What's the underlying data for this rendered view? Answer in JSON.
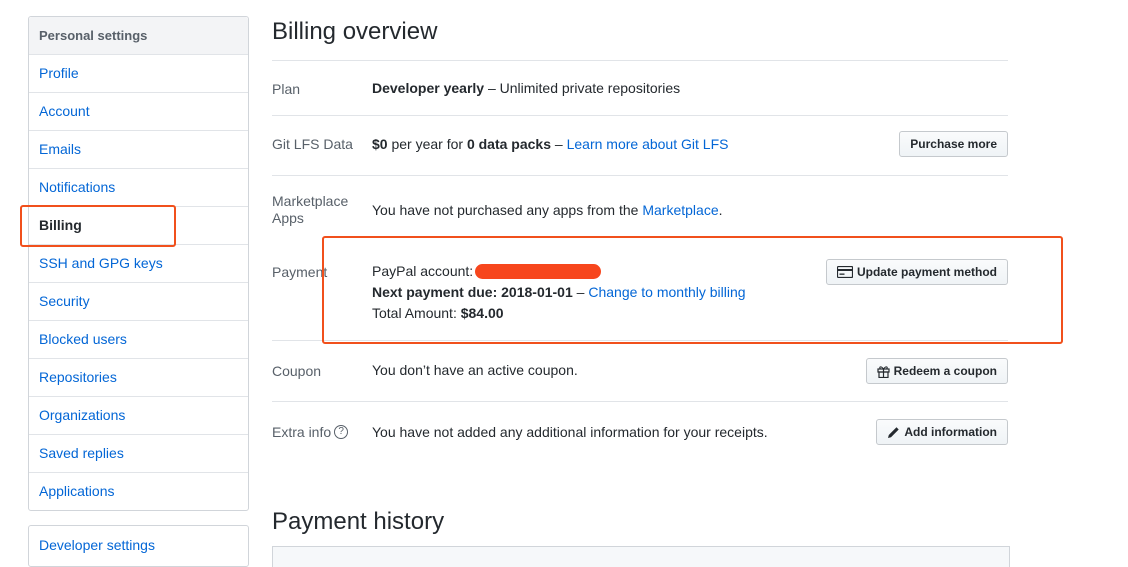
{
  "sidebar": {
    "header": "Personal settings",
    "items": [
      {
        "label": "Profile"
      },
      {
        "label": "Account"
      },
      {
        "label": "Emails"
      },
      {
        "label": "Notifications"
      },
      {
        "label": "Billing"
      },
      {
        "label": "SSH and GPG keys"
      },
      {
        "label": "Security"
      },
      {
        "label": "Blocked users"
      },
      {
        "label": "Repositories"
      },
      {
        "label": "Organizations"
      },
      {
        "label": "Saved replies"
      },
      {
        "label": "Applications"
      }
    ],
    "selected": "Billing",
    "developer_settings": "Developer settings"
  },
  "billing": {
    "title": "Billing overview",
    "plan": {
      "label": "Plan",
      "name": "Developer yearly",
      "sep": " – ",
      "desc": "Unlimited private repositories"
    },
    "lfs": {
      "label": "Git LFS Data",
      "price": "$0",
      "text1": " per year for ",
      "packs": "0 data packs",
      "sep": " – ",
      "link": "Learn more about Git LFS",
      "button": "Purchase more"
    },
    "marketplace": {
      "label_line1": "Marketplace",
      "label_line2": "Apps",
      "text": "You have not purchased any apps from the ",
      "link": "Marketplace",
      "period": "."
    },
    "payment": {
      "label": "Payment",
      "paypal_label": "PayPal account:",
      "next_label": "Next payment due: ",
      "next_date": "2018-01-01",
      "sep": " – ",
      "change_link": "Change to monthly billing",
      "total_label": "Total Amount: ",
      "total_value": "$84.00",
      "button": "Update payment method"
    },
    "coupon": {
      "label": "Coupon",
      "text": "You don’t have an active coupon.",
      "button": "Redeem a coupon"
    },
    "extra": {
      "label": "Extra info",
      "help": "?",
      "text": "You have not added any additional information for your receipts.",
      "button": "Add information"
    }
  },
  "history": {
    "title": "Payment history"
  },
  "colors": {
    "link": "#0366d6",
    "highlight": "#f1501c",
    "redaction": "#f7461d"
  }
}
